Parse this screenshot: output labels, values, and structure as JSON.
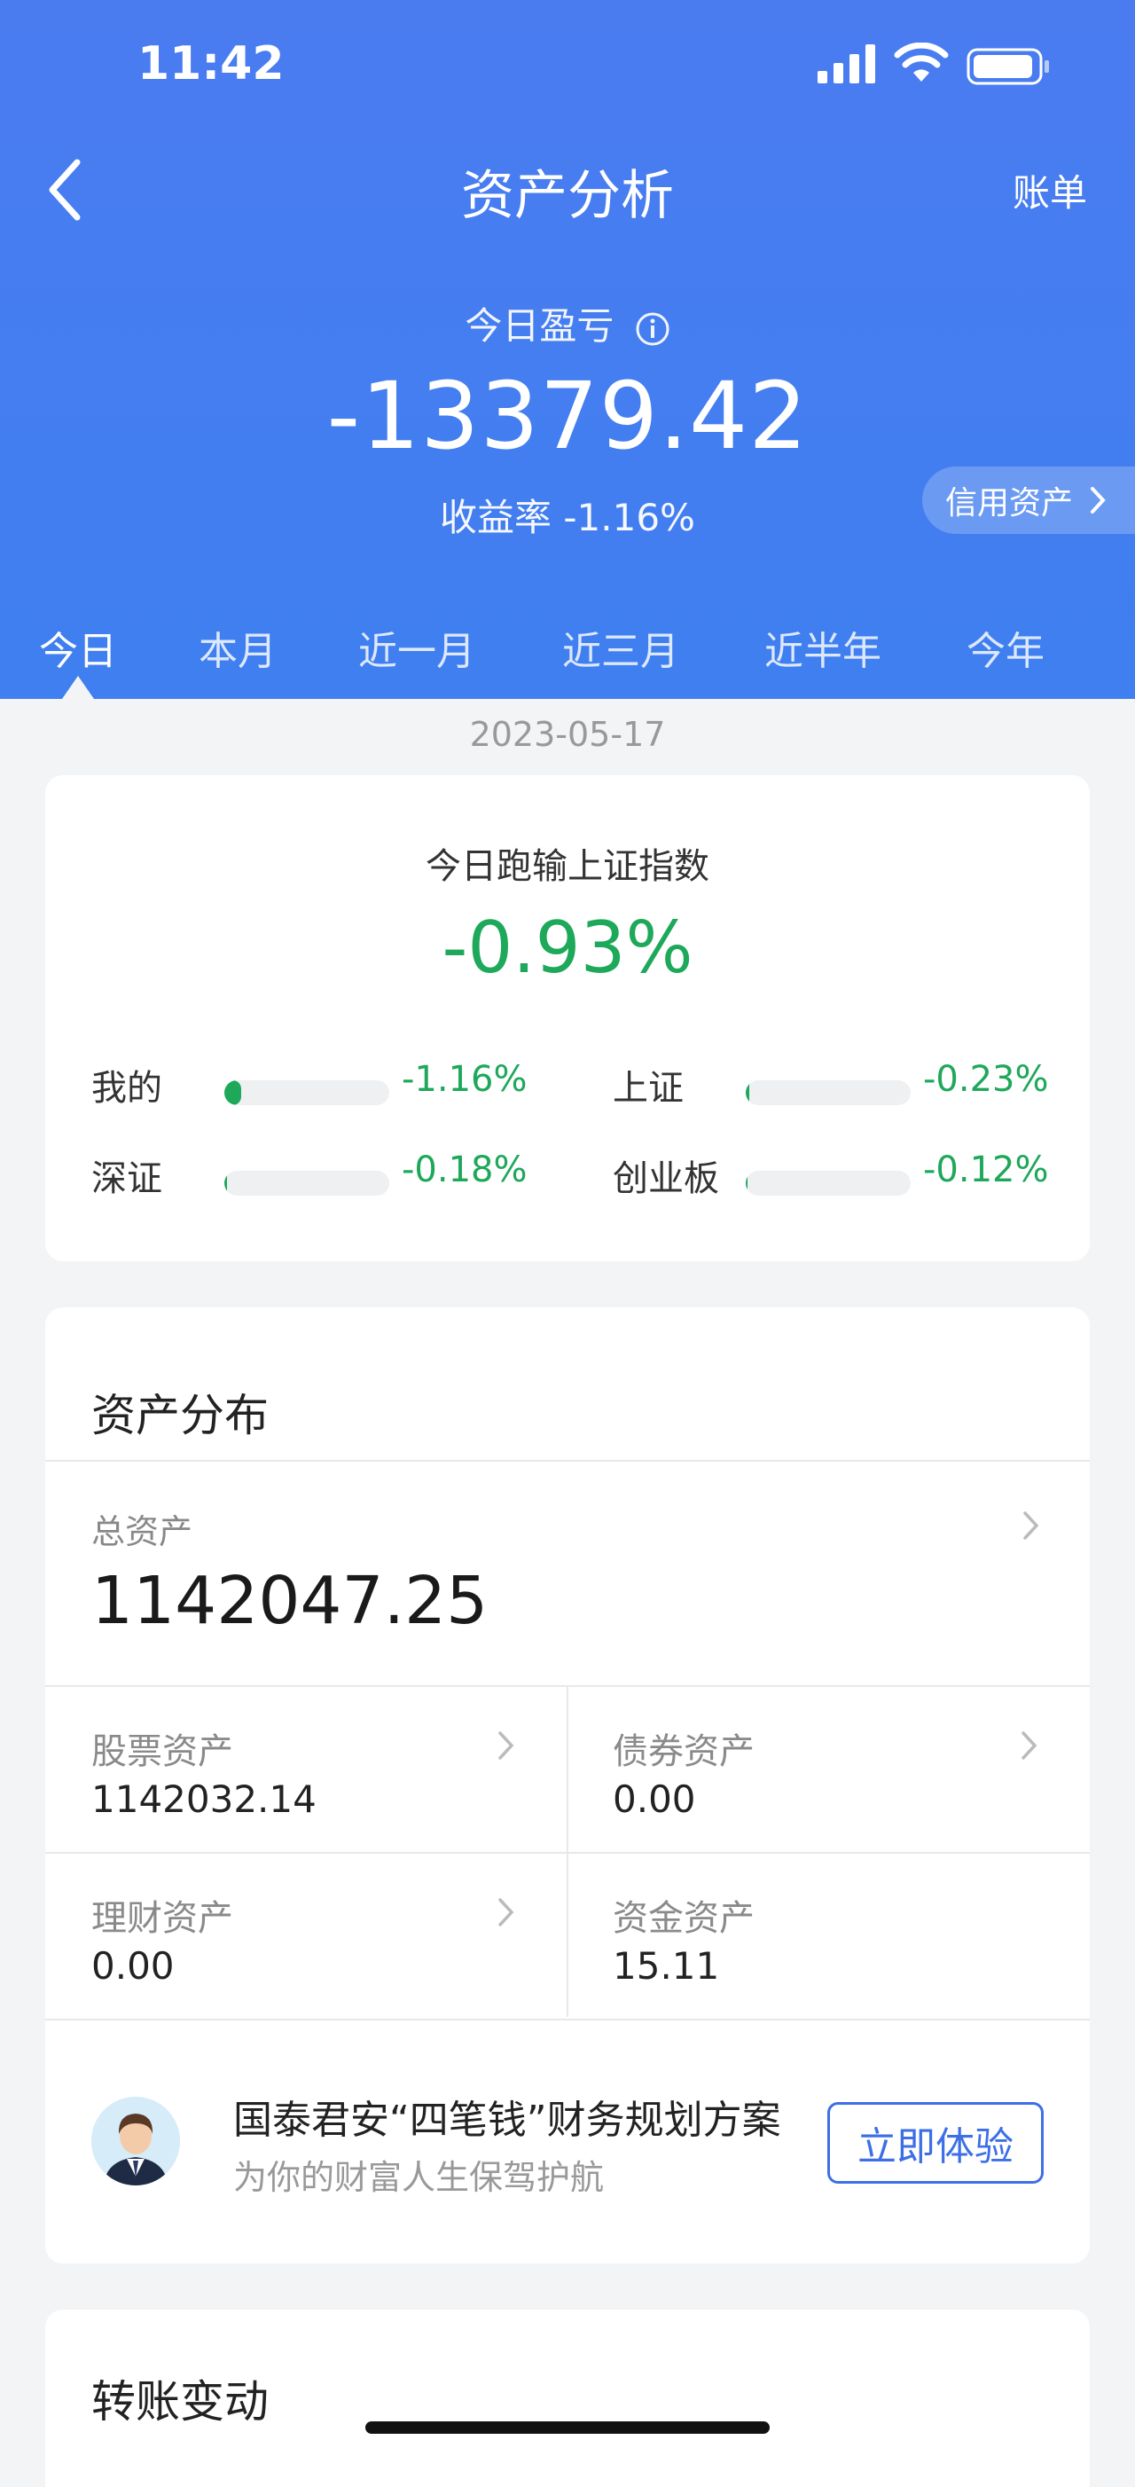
{
  "status_bar": {
    "time": "11:42"
  },
  "nav": {
    "title": "资产分析",
    "bill_label": "账单"
  },
  "summary": {
    "pnl_label": "今日盈亏",
    "pnl_value": "-13379.42",
    "return_rate_label": "收益率 -1.16%",
    "credit_assets_label": "信用资产"
  },
  "tabs": [
    {
      "label": "今日",
      "active": true
    },
    {
      "label": "本月"
    },
    {
      "label": "近一月"
    },
    {
      "label": "近三月"
    },
    {
      "label": "近半年"
    },
    {
      "label": "今年"
    }
  ],
  "date": "2023-05-17",
  "comparison": {
    "title": "今日跑输上证指数",
    "value": "-0.93%",
    "items": [
      {
        "label": "我的",
        "value": "-1.16%",
        "fill_percent": 10
      },
      {
        "label": "上证",
        "value": "-0.23%",
        "fill_percent": 2
      },
      {
        "label": "深证",
        "value": "-0.18%",
        "fill_percent": 1.5
      },
      {
        "label": "创业板",
        "value": "-0.12%",
        "fill_percent": 1
      }
    ]
  },
  "assets": {
    "title": "资产分布",
    "total_label": "总资产",
    "total_value": "1142047.25",
    "stock_label": "股票资产",
    "stock_value": "1142032.14",
    "bond_label": "债券资产",
    "bond_value": "0.00",
    "wealth_label": "理财资产",
    "wealth_value": "0.00",
    "cash_label": "资金资产",
    "cash_value": "15.11"
  },
  "promo": {
    "title": "国泰君安“四笔钱”财务规划方案",
    "subtitle": "为你的财富人生保驾护航",
    "button_label": "立即体验"
  },
  "transfer": {
    "title": "转账变动"
  },
  "colors": {
    "header_blue": "#4a7cf0",
    "negative_green": "#1ea85a",
    "accent_blue": "#3d6fe6"
  }
}
